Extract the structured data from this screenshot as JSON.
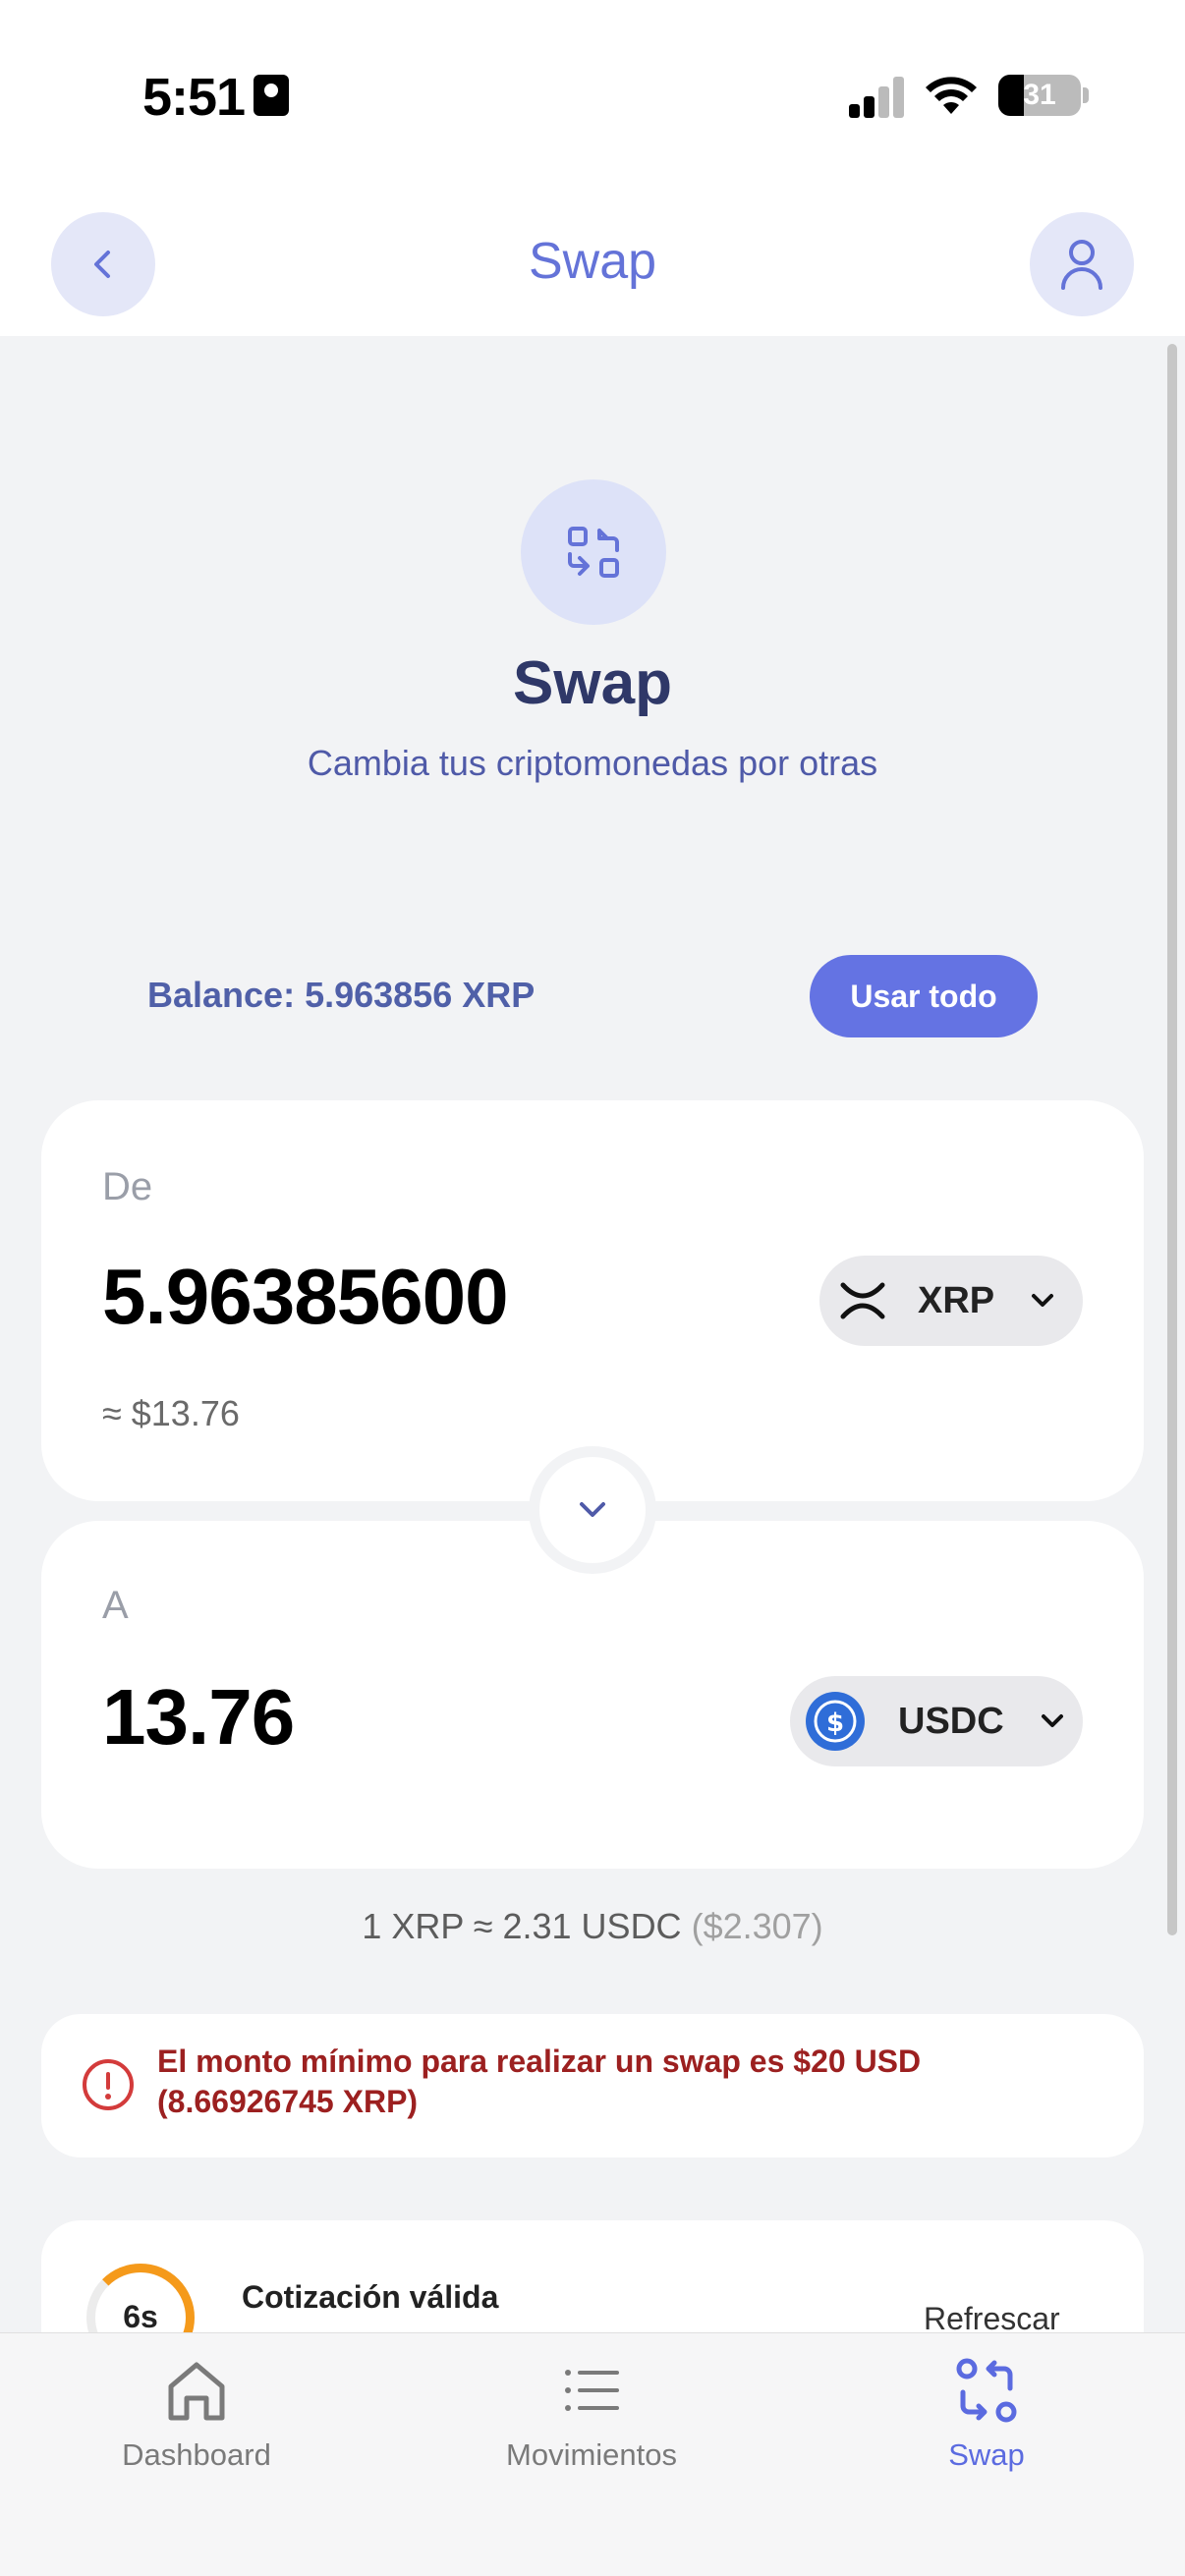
{
  "status_bar": {
    "time": "5:51",
    "battery": "31"
  },
  "header": {
    "title": "Swap"
  },
  "hero": {
    "title": "Swap",
    "subtitle": "Cambia tus criptomonedas por otras"
  },
  "balance": {
    "text": "Balance: 5.963856 XRP",
    "use_all_label": "Usar todo"
  },
  "from": {
    "label": "De",
    "amount": "5.96385600",
    "fiat": "≈ $13.76",
    "token": "XRP"
  },
  "to": {
    "label": "A",
    "amount": "13.76",
    "token": "USDC"
  },
  "rate": {
    "text": "1 XRP ≈ 2.31 USDC",
    "usd": "($2.307)"
  },
  "error": {
    "message": "El monto mínimo para realizar un swap es $20 USD (8.66926745 XRP)"
  },
  "quote": {
    "timer": "6s",
    "title": "Cotización válida",
    "refresh_label": "Refrescar"
  },
  "tabs": [
    {
      "label": "Dashboard",
      "icon": "home-icon"
    },
    {
      "label": "Movimientos",
      "icon": "list-icon"
    },
    {
      "label": "Swap",
      "icon": "swap-icon"
    }
  ],
  "colors": {
    "accent": "#6473e3",
    "error": "#9c2020",
    "timer": "#f59a1b"
  }
}
